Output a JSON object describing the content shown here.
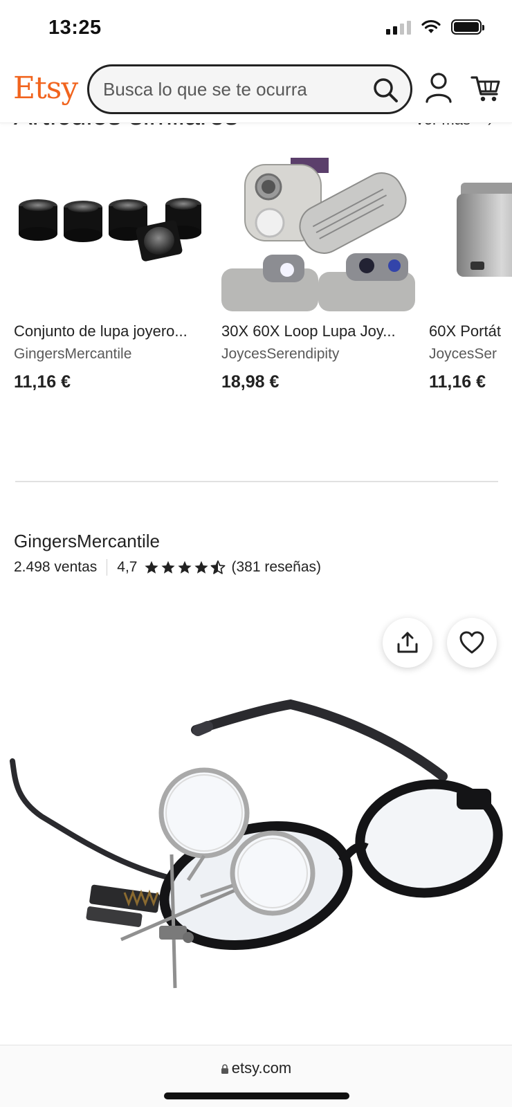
{
  "status_bar": {
    "time": "13:25"
  },
  "header": {
    "logo": "Etsy",
    "search_placeholder": "Busca lo que se te ocurra",
    "brand_color": "#f1641e"
  },
  "similar_items": {
    "heading": "Artículos similares",
    "see_more": "Ver más",
    "items": [
      {
        "title": "Conjunto de lupa joyero...",
        "shop": "GingersMercantile",
        "price": "11,16 €",
        "image": "eye-loupe-set"
      },
      {
        "title": "30X 60X Loop Lupa Joy...",
        "shop": "JoycesSerendipity",
        "price": "18,98 €",
        "image": "folding-loupe-led"
      },
      {
        "title": "60X Portát",
        "shop": "JoycesSer",
        "price": "11,16 €",
        "image": "silver-pocket-microscope"
      }
    ]
  },
  "shop": {
    "name": "GingersMercantile",
    "sales": "2.498 ventas",
    "rating": "4,7",
    "rating_value": 4.7,
    "reviews": "(381 reseñas)"
  },
  "main_image": {
    "subject": "glasses-with-flip-magnifier"
  },
  "browser": {
    "url": "etsy.com"
  }
}
